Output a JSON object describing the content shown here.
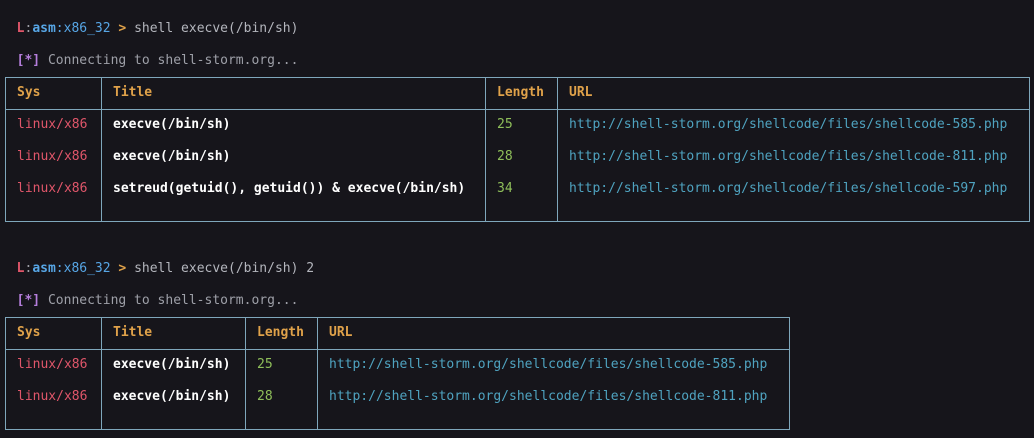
{
  "prompt": {
    "l": "L",
    "sep": ":",
    "asm": "asm",
    "arch": ":x86_32",
    "gt": ">"
  },
  "blocks": [
    {
      "command": "shell execve(/bin/sh)",
      "info_marker": "[*]",
      "info_text": "Connecting to shell-storm.org...",
      "headers": [
        "Sys",
        "Title",
        "Length",
        "URL"
      ],
      "rows": [
        {
          "sys": "linux/x86",
          "title": "execve(/bin/sh)",
          "length": "25",
          "url": "http://shell-storm.org/shellcode/files/shellcode-585.php"
        },
        {
          "sys": "linux/x86",
          "title": "execve(/bin/sh)",
          "length": "28",
          "url": "http://shell-storm.org/shellcode/files/shellcode-811.php"
        },
        {
          "sys": "linux/x86",
          "title": "setreud(getuid(), getuid()) & execve(/bin/sh)",
          "length": "34",
          "url": "http://shell-storm.org/shellcode/files/shellcode-597.php"
        }
      ]
    },
    {
      "command": "shell execve(/bin/sh) 2",
      "info_marker": "[*]",
      "info_text": "Connecting to shell-storm.org...",
      "headers": [
        "Sys",
        "Title",
        "Length",
        "URL"
      ],
      "rows": [
        {
          "sys": "linux/x86",
          "title": "execve(/bin/sh)",
          "length": "25",
          "url": "http://shell-storm.org/shellcode/files/shellcode-585.php"
        },
        {
          "sys": "linux/x86",
          "title": "execve(/bin/sh)",
          "length": "28",
          "url": "http://shell-storm.org/shellcode/files/shellcode-811.php"
        }
      ]
    }
  ]
}
